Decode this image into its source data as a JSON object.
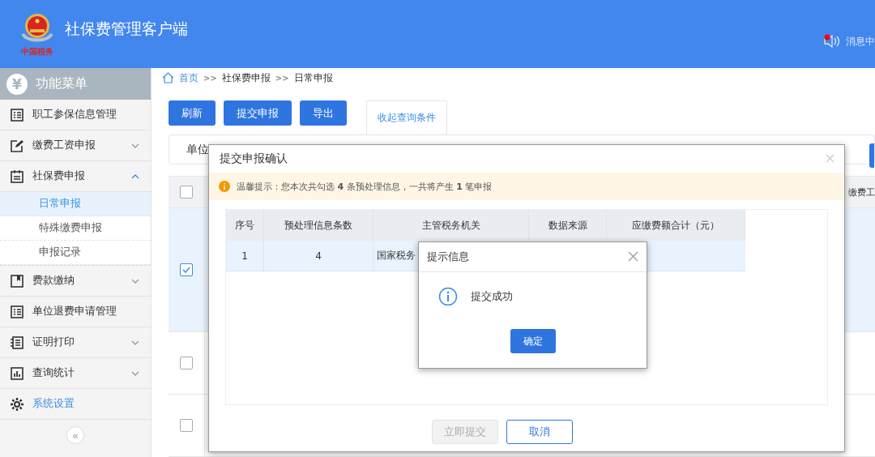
{
  "header": {
    "title": "社保费管理客户端",
    "logo_text": "中国税务",
    "notice_label": "消息中",
    "notice_unread": true
  },
  "sidebar": {
    "menu_icon": "¥",
    "title": "功能菜单",
    "items": [
      {
        "label": "职工参保信息管理",
        "highlighted": false
      },
      {
        "label": "缴费工资申报",
        "expanded": false,
        "highlighted": false
      },
      {
        "label": "社保费申报",
        "expanded": true,
        "highlighted": false,
        "children": [
          {
            "label": "日常申报",
            "selected": true
          },
          {
            "label": "特殊缴费申报",
            "selected": false
          },
          {
            "label": "申报记录",
            "selected": false
          }
        ]
      },
      {
        "label": "费款缴纳",
        "expanded": false,
        "highlighted": false
      },
      {
        "label": "单位退费申请管理",
        "highlighted": false
      },
      {
        "label": "证明打印",
        "expanded": false,
        "highlighted": false
      },
      {
        "label": "查询统计",
        "expanded": false,
        "highlighted": false
      },
      {
        "label": "系统设置",
        "highlighted": true
      }
    ],
    "collapse_icon": "«"
  },
  "breadcrumb": {
    "items": [
      "首页",
      "社保费申报",
      "日常申报"
    ],
    "separators": [
      ">>",
      ">>"
    ]
  },
  "toolbar": {
    "buttons": [
      "刷新",
      "提交申报",
      "导出"
    ],
    "toggle": "收起查询条件"
  },
  "query": {
    "label": "单位"
  },
  "table": {
    "header_checked": false,
    "partial_column": "缴费工",
    "rows": [
      {
        "checked": true
      },
      {
        "checked": false
      },
      {
        "checked": false
      }
    ]
  },
  "confirm_dialog": {
    "title": "提交申报确认",
    "notice": "温馨提示：您本次共勾选 **4** 条预处理信息，一共将产生 **1** 笔申报",
    "columns": [
      "序号",
      "预处理信息条数",
      "主管税务机关",
      "数据来源",
      "应缴费额合计（元）"
    ],
    "rows": [
      [
        "1",
        "4",
        "国家税务"
      ]
    ],
    "buttons": [
      {
        "label": "立即提交",
        "kind": "primary",
        "disabled": true
      },
      {
        "label": "取消",
        "kind": "outline",
        "disabled": false
      }
    ]
  },
  "message_dialog": {
    "title": "提示信息",
    "message": "提交成功",
    "button": "确定"
  }
}
